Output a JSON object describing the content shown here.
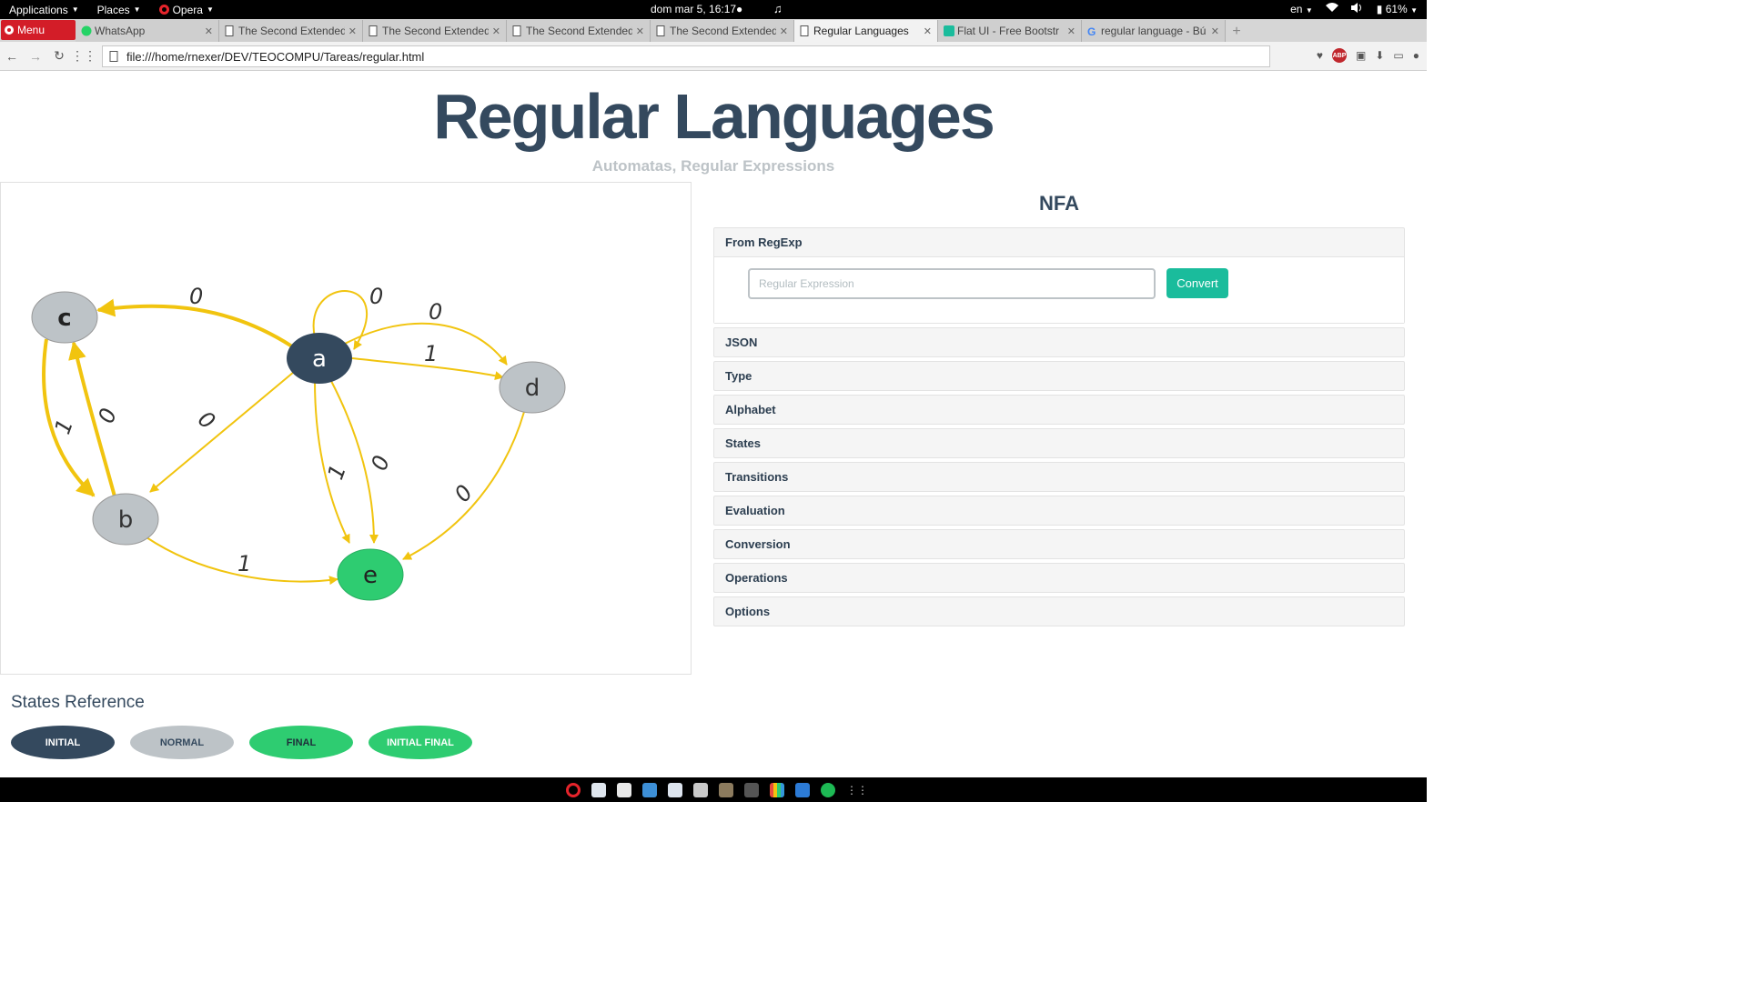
{
  "system": {
    "menus": [
      "Applications",
      "Places",
      "Opera"
    ],
    "clock": "dom mar  5, 16:17●",
    "lang": "en",
    "battery": "61%"
  },
  "browser": {
    "menu_label": "Menu",
    "tabs": [
      {
        "label": "WhatsApp",
        "active": false
      },
      {
        "label": "The Second Extended",
        "active": false
      },
      {
        "label": "The Second Extended",
        "active": false
      },
      {
        "label": "The Second Extended",
        "active": false
      },
      {
        "label": "The Second Extended",
        "active": false
      },
      {
        "label": "Regular Languages",
        "active": true
      },
      {
        "label": "Flat UI - Free Bootstr",
        "active": false
      },
      {
        "label": "regular language - Bú",
        "active": false
      }
    ],
    "url": "file:///home/rnexer/DEV/TEOCOMPU/Tareas/regular.html"
  },
  "page": {
    "title": "Regular Languages",
    "subtitle": "Automatas, Regular Expressions",
    "nfa_title": "NFA"
  },
  "graph": {
    "states": {
      "a": "a",
      "b": "b",
      "c": "c",
      "d": "d",
      "e": "e"
    },
    "transitions": [
      {
        "from": "a",
        "to": "a",
        "symbol": "0"
      },
      {
        "from": "a",
        "to": "c",
        "symbol": "0"
      },
      {
        "from": "a",
        "to": "d",
        "symbol": "0"
      },
      {
        "from": "a",
        "to": "d",
        "symbol": "1"
      },
      {
        "from": "a",
        "to": "b",
        "symbol": "0"
      },
      {
        "from": "a",
        "to": "e",
        "symbol": "1"
      },
      {
        "from": "a",
        "to": "e",
        "symbol": "0"
      },
      {
        "from": "c",
        "to": "b",
        "symbol": "1"
      },
      {
        "from": "b",
        "to": "c",
        "symbol": "0"
      },
      {
        "from": "b",
        "to": "e",
        "symbol": "1"
      },
      {
        "from": "d",
        "to": "e",
        "symbol": "0"
      }
    ],
    "colors": {
      "initial": "#34495e",
      "normal": "#bdc3c7",
      "final": "#2ecc71",
      "edge": "#f1c40f"
    }
  },
  "accordion": {
    "from_regexp": {
      "label": "From RegExp",
      "input_placeholder": "Regular Expression",
      "button": "Convert"
    },
    "sections": [
      "JSON",
      "Type",
      "Alphabet",
      "States",
      "Transitions",
      "Evaluation",
      "Conversion",
      "Operations",
      "Options"
    ]
  },
  "states_reference": {
    "title": "States Reference",
    "items": [
      "INITIAL",
      "NORMAL",
      "FINAL",
      "INITIAL FINAL"
    ]
  }
}
